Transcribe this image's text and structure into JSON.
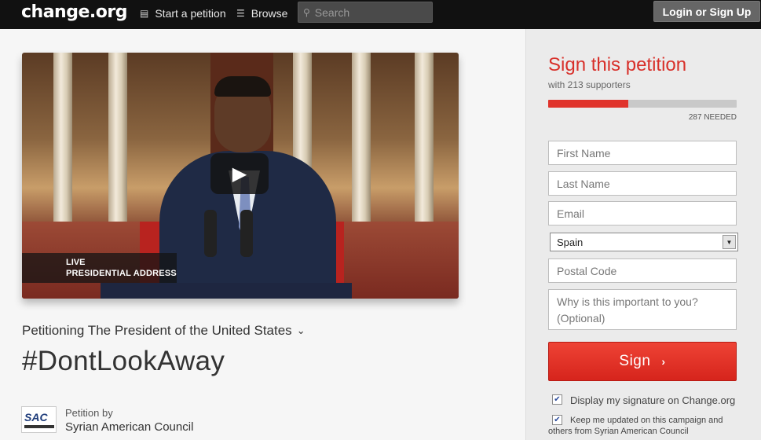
{
  "nav": {
    "logo": "change.org",
    "start_petition": "Start a petition",
    "browse": "Browse",
    "search_placeholder": "Search",
    "login": "Login or Sign Up"
  },
  "video": {
    "overlay_line1": "LIVE",
    "overlay_line2": "PRESIDENTIAL ADDRESS",
    "play_icon": "play-icon"
  },
  "petition": {
    "petitioning": "Petitioning The President of the United States",
    "title": "#DontLookAway",
    "petition_by_label": "Petition by",
    "org_name": "Syrian American Council",
    "org_logo_text": "SAC"
  },
  "sign_panel": {
    "title": "Sign this petition",
    "supporters": "with 213 supporters",
    "progress_fraction": 0.426,
    "needed": "287 NEEDED",
    "first_name_placeholder": "First Name",
    "last_name_placeholder": "Last Name",
    "email_placeholder": "Email",
    "country_value": "Spain",
    "postal_placeholder": "Postal Code",
    "why_placeholder": "Why is this important to you? (Optional)",
    "sign_button": "Sign",
    "display_signature_label": "Display my signature on Change.org",
    "keep_updated_label": "Keep me updated on this campaign and others from Syrian American Council",
    "display_signature_checked": true,
    "keep_updated_checked": true
  },
  "colors": {
    "accent": "#e0332b",
    "topbar": "#111111"
  }
}
